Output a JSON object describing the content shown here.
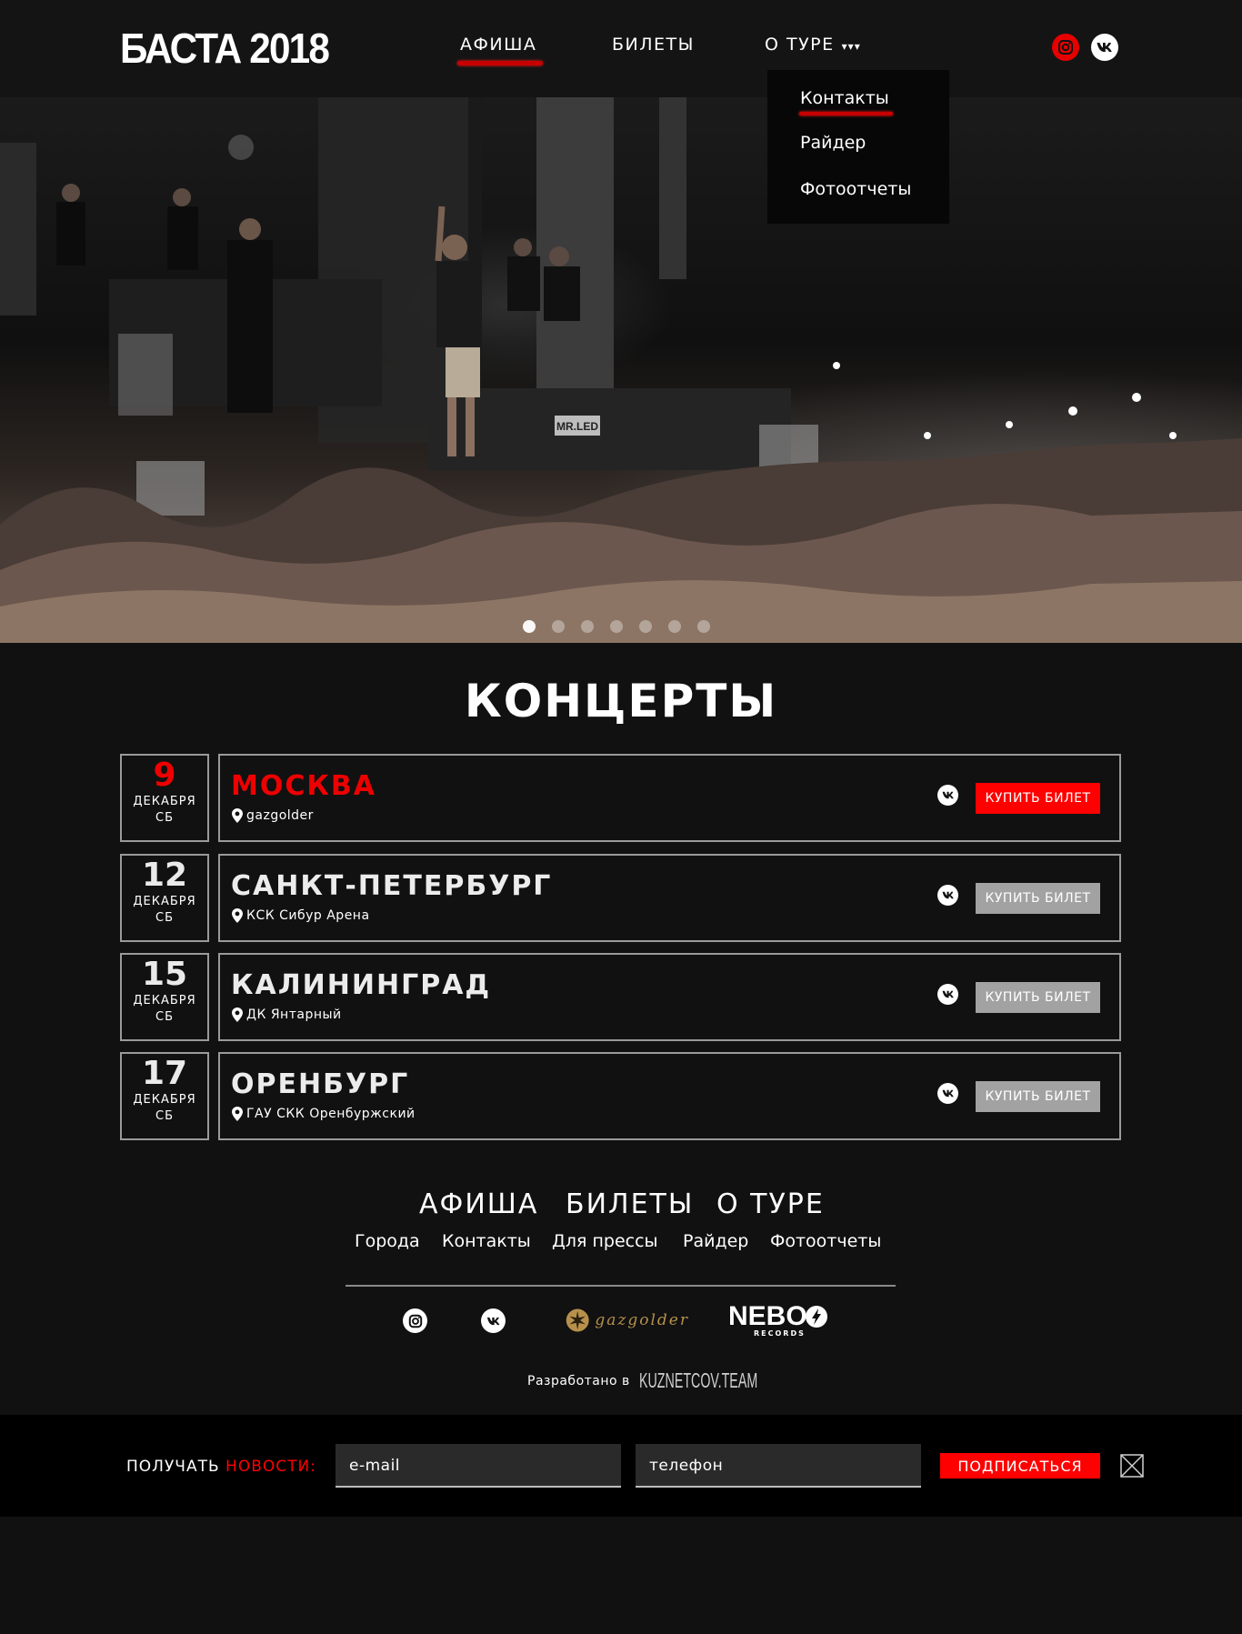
{
  "header": {
    "logo": "БАСТА 2018",
    "nav": {
      "afisha": "АФИША",
      "bilety": "БИЛЕТЫ",
      "tour": "О ТУРЕ",
      "tour_caret": "▾▾▾"
    },
    "dropdown": [
      "Контакты",
      "Райдер",
      "Фотоотчеты"
    ],
    "social": [
      "instagram-icon",
      "vk-icon"
    ]
  },
  "hero": {
    "slides_count": 7,
    "active_slide": 1,
    "stage_sign": "MR.LED"
  },
  "concerts": {
    "title": "КОНЦЕРТЫ",
    "rows": [
      {
        "day": "9",
        "month": "ДЕКАБРЯ",
        "weekday": "СБ",
        "city": "МОСКВА",
        "venue": "gazgolder",
        "button": "КУПИТЬ БИЛЕТ",
        "highlight": true
      },
      {
        "day": "12",
        "month": "ДЕКАБРЯ",
        "weekday": "СБ",
        "city": "САНКТ-ПЕТЕРБУРГ",
        "venue": "КСК Сибур Арена",
        "button": "КУПИТЬ БИЛЕТ",
        "highlight": false
      },
      {
        "day": "15",
        "month": "ДЕКАБРЯ",
        "weekday": "СБ",
        "city": "КАЛИНИНГРАД",
        "venue": "ДК Янтарный",
        "button": "КУПИТЬ БИЛЕТ",
        "highlight": false
      },
      {
        "day": "17",
        "month": "ДЕКАБРЯ",
        "weekday": "СБ",
        "city": "ОРЕНБУРГ",
        "venue": "ГАУ СКК Оренбуржский",
        "button": "КУПИТЬ БИЛЕТ",
        "highlight": false
      }
    ]
  },
  "footer": {
    "main_links": [
      "АФИША",
      "БИЛЕТЫ",
      "О ТУРЕ"
    ],
    "sub_links": [
      "Города",
      "Контакты",
      "Для прессы",
      "Райдер",
      "Фотоотчеты"
    ],
    "partner_gazgolder": "gazgolder",
    "partner_nebo": "NEBO",
    "partner_nebo_sub": "RECORDS",
    "developed_label": "Разработано в",
    "developer": "KUZNETCOV.TEAM"
  },
  "subscribe": {
    "label_prefix": "ПОЛУЧАТЬ",
    "label_highlight": "НОВОСТИ:",
    "email_placeholder": "e-mail",
    "phone_placeholder": "телефон",
    "button": "ПОДПИСАТЬСЯ"
  },
  "colors": {
    "accent": "#ff0000",
    "background": "#111111",
    "header": "#141414",
    "border": "#9a9a9a",
    "button_grey": "#a2a2a2",
    "gazgolder_gold": "#b7914c"
  }
}
